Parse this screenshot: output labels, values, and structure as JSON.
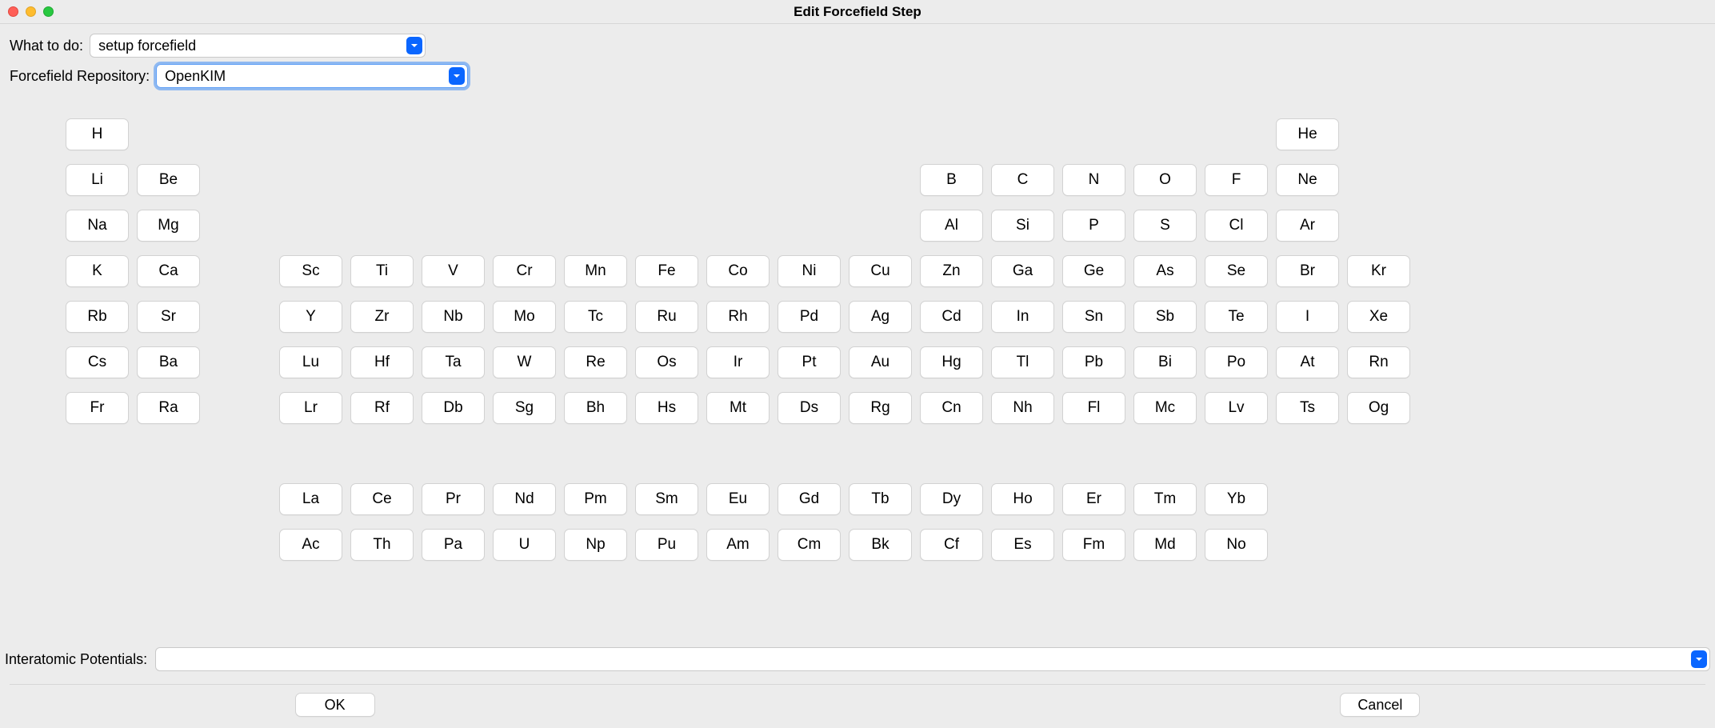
{
  "window": {
    "title": "Edit Forcefield Step"
  },
  "form": {
    "what_to_do": {
      "label": "What to do:",
      "value": "setup forcefield"
    },
    "repo": {
      "label": "Forcefield Repository:",
      "value": "OpenKIM"
    },
    "potentials": {
      "label": "Interatomic Potentials:",
      "value": ""
    }
  },
  "buttons": {
    "ok": "OK",
    "cancel": "Cancel"
  },
  "periodic_table": {
    "rows": [
      [
        {
          "c": 1,
          "s": "H"
        },
        {
          "c": 18,
          "s": "He"
        }
      ],
      [
        {
          "c": 1,
          "s": "Li"
        },
        {
          "c": 2,
          "s": "Be"
        },
        {
          "c": 13,
          "s": "B"
        },
        {
          "c": 14,
          "s": "C"
        },
        {
          "c": 15,
          "s": "N"
        },
        {
          "c": 16,
          "s": "O"
        },
        {
          "c": 17,
          "s": "F"
        },
        {
          "c": 18,
          "s": "Ne"
        }
      ],
      [
        {
          "c": 1,
          "s": "Na"
        },
        {
          "c": 2,
          "s": "Mg"
        },
        {
          "c": 13,
          "s": "Al"
        },
        {
          "c": 14,
          "s": "Si"
        },
        {
          "c": 15,
          "s": "P"
        },
        {
          "c": 16,
          "s": "S"
        },
        {
          "c": 17,
          "s": "Cl"
        },
        {
          "c": 18,
          "s": "Ar"
        }
      ],
      [
        {
          "c": 1,
          "s": "K"
        },
        {
          "c": 2,
          "s": "Ca"
        },
        {
          "c": 4,
          "s": "Sc"
        },
        {
          "c": 5,
          "s": "Ti"
        },
        {
          "c": 6,
          "s": "V"
        },
        {
          "c": 7,
          "s": "Cr"
        },
        {
          "c": 8,
          "s": "Mn"
        },
        {
          "c": 9,
          "s": "Fe"
        },
        {
          "c": 10,
          "s": "Co"
        },
        {
          "c": 11,
          "s": "Ni"
        },
        {
          "c": 12,
          "s": "Cu"
        },
        {
          "c": 13,
          "s": "Zn"
        },
        {
          "c": 14,
          "s": "Ga"
        },
        {
          "c": 15,
          "s": "Ge"
        },
        {
          "c": 16,
          "s": "As"
        },
        {
          "c": 17,
          "s": "Se"
        },
        {
          "c": 18,
          "s": "Br"
        },
        {
          "c": 19,
          "s": "Kr"
        }
      ],
      [
        {
          "c": 1,
          "s": "Rb"
        },
        {
          "c": 2,
          "s": "Sr"
        },
        {
          "c": 4,
          "s": "Y"
        },
        {
          "c": 5,
          "s": "Zr"
        },
        {
          "c": 6,
          "s": "Nb"
        },
        {
          "c": 7,
          "s": "Mo"
        },
        {
          "c": 8,
          "s": "Tc"
        },
        {
          "c": 9,
          "s": "Ru"
        },
        {
          "c": 10,
          "s": "Rh"
        },
        {
          "c": 11,
          "s": "Pd"
        },
        {
          "c": 12,
          "s": "Ag"
        },
        {
          "c": 13,
          "s": "Cd"
        },
        {
          "c": 14,
          "s": "In"
        },
        {
          "c": 15,
          "s": "Sn"
        },
        {
          "c": 16,
          "s": "Sb"
        },
        {
          "c": 17,
          "s": "Te"
        },
        {
          "c": 18,
          "s": "I"
        },
        {
          "c": 19,
          "s": "Xe"
        }
      ],
      [
        {
          "c": 1,
          "s": "Cs"
        },
        {
          "c": 2,
          "s": "Ba"
        },
        {
          "c": 4,
          "s": "Lu"
        },
        {
          "c": 5,
          "s": "Hf"
        },
        {
          "c": 6,
          "s": "Ta"
        },
        {
          "c": 7,
          "s": "W"
        },
        {
          "c": 8,
          "s": "Re"
        },
        {
          "c": 9,
          "s": "Os"
        },
        {
          "c": 10,
          "s": "Ir"
        },
        {
          "c": 11,
          "s": "Pt"
        },
        {
          "c": 12,
          "s": "Au"
        },
        {
          "c": 13,
          "s": "Hg"
        },
        {
          "c": 14,
          "s": "Tl"
        },
        {
          "c": 15,
          "s": "Pb"
        },
        {
          "c": 16,
          "s": "Bi"
        },
        {
          "c": 17,
          "s": "Po"
        },
        {
          "c": 18,
          "s": "At"
        },
        {
          "c": 19,
          "s": "Rn"
        }
      ],
      [
        {
          "c": 1,
          "s": "Fr"
        },
        {
          "c": 2,
          "s": "Ra"
        },
        {
          "c": 4,
          "s": "Lr"
        },
        {
          "c": 5,
          "s": "Rf"
        },
        {
          "c": 6,
          "s": "Db"
        },
        {
          "c": 7,
          "s": "Sg"
        },
        {
          "c": 8,
          "s": "Bh"
        },
        {
          "c": 9,
          "s": "Hs"
        },
        {
          "c": 10,
          "s": "Mt"
        },
        {
          "c": 11,
          "s": "Ds"
        },
        {
          "c": 12,
          "s": "Rg"
        },
        {
          "c": 13,
          "s": "Cn"
        },
        {
          "c": 14,
          "s": "Nh"
        },
        {
          "c": 15,
          "s": "Fl"
        },
        {
          "c": 16,
          "s": "Mc"
        },
        {
          "c": 17,
          "s": "Lv"
        },
        {
          "c": 18,
          "s": "Ts"
        },
        {
          "c": 19,
          "s": "Og"
        }
      ],
      [
        {
          "c": 4,
          "s": "La"
        },
        {
          "c": 5,
          "s": "Ce"
        },
        {
          "c": 6,
          "s": "Pr"
        },
        {
          "c": 7,
          "s": "Nd"
        },
        {
          "c": 8,
          "s": "Pm"
        },
        {
          "c": 9,
          "s": "Sm"
        },
        {
          "c": 10,
          "s": "Eu"
        },
        {
          "c": 11,
          "s": "Gd"
        },
        {
          "c": 12,
          "s": "Tb"
        },
        {
          "c": 13,
          "s": "Dy"
        },
        {
          "c": 14,
          "s": "Ho"
        },
        {
          "c": 15,
          "s": "Er"
        },
        {
          "c": 16,
          "s": "Tm"
        },
        {
          "c": 17,
          "s": "Yb"
        }
      ],
      [
        {
          "c": 4,
          "s": "Ac"
        },
        {
          "c": 5,
          "s": "Th"
        },
        {
          "c": 6,
          "s": "Pa"
        },
        {
          "c": 7,
          "s": "U"
        },
        {
          "c": 8,
          "s": "Np"
        },
        {
          "c": 9,
          "s": "Pu"
        },
        {
          "c": 10,
          "s": "Am"
        },
        {
          "c": 11,
          "s": "Cm"
        },
        {
          "c": 12,
          "s": "Bk"
        },
        {
          "c": 13,
          "s": "Cf"
        },
        {
          "c": 14,
          "s": "Es"
        },
        {
          "c": 15,
          "s": "Fm"
        },
        {
          "c": 16,
          "s": "Md"
        },
        {
          "c": 17,
          "s": "No"
        }
      ]
    ]
  }
}
